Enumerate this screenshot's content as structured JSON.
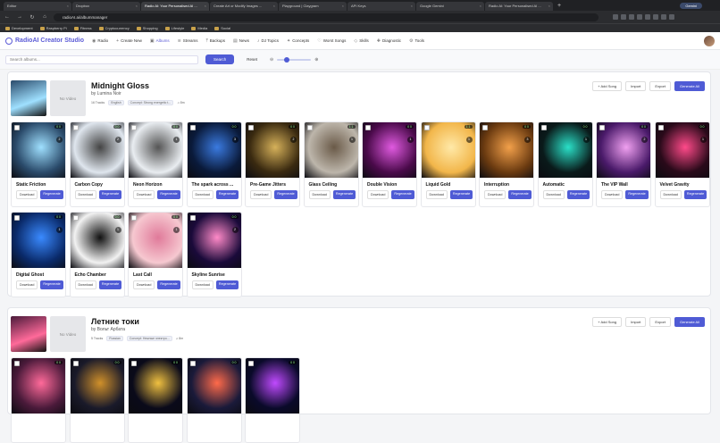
{
  "browser": {
    "tabs": [
      "Editor",
      "Dropbox",
      "Radio AI: Your Personalised AI ...",
      "Create Art or Modify Images ...",
      "Playground | Claygram",
      "API Keys",
      "Google Gemini",
      "Radio AI: Your Personalised AI ..."
    ],
    "gemini_label": "Gemini",
    "url": "radioAI.ai/albummanager",
    "bookmarks": [
      "Development",
      "Raspberry Pi",
      "Fitness",
      "Cryptocurrency",
      "Shopping",
      "Lifestyle",
      "Media",
      "Social"
    ]
  },
  "app": {
    "brand": "RadioAI Creator Studio",
    "nav": [
      {
        "label": "Radio",
        "icon": "radio-icon"
      },
      {
        "label": "Create New",
        "icon": "plus-icon"
      },
      {
        "label": "Albums",
        "icon": "album-icon"
      },
      {
        "label": "Streams",
        "icon": "stream-icon"
      },
      {
        "label": "Backups",
        "icon": "backup-icon"
      },
      {
        "label": "News",
        "icon": "news-icon"
      },
      {
        "label": "DJ Topics",
        "icon": "mic-icon"
      },
      {
        "label": "Concepts",
        "icon": "bulb-icon"
      },
      {
        "label": "Worst Songs",
        "icon": "thumb-down-icon"
      },
      {
        "label": "Skills",
        "icon": "skill-icon"
      },
      {
        "label": "Diagnostic",
        "icon": "diagnostic-icon"
      },
      {
        "label": "Tools",
        "icon": "tools-icon"
      }
    ],
    "active_nav": "Albums"
  },
  "toolbar": {
    "search_placeholder": "Search albums...",
    "search_label": "Search",
    "reset_label": "Reset",
    "zoom_level": 0.25
  },
  "albums": [
    {
      "title": "Midnight Gloss",
      "artist": "by Lumina Noir",
      "tracks": "16 Tracks",
      "language": "English",
      "concept": "Concept: Strong energetic t...",
      "likes": "♫ 8m",
      "no_video": "No Video",
      "actions": {
        "add": "+ Add Song",
        "import": "Import",
        "export": "Export",
        "generate": "Generate All"
      },
      "songs": [
        {
          "name": "Static Friction",
          "status": "0 0",
          "num": "2",
          "c1": "#2a4a6a",
          "c2": "#9fe0ff"
        },
        {
          "name": "Carbon Copy",
          "status": "0 0",
          "num": "2",
          "c1": "#dfe6ee",
          "c2": "#444"
        },
        {
          "name": "Neon Horizon",
          "status": "0 0",
          "num": "1",
          "c1": "#e9edf1",
          "c2": "#555"
        },
        {
          "name": "The spark across ...",
          "status": "0 0",
          "num": "3",
          "c1": "#0a1a3a",
          "c2": "#3a7ae0"
        },
        {
          "name": "Pre-Game Jitters",
          "status": "0 0",
          "num": "2",
          "c1": "#3a2a10",
          "c2": "#d6b15a"
        },
        {
          "name": "Glass Ceiling",
          "status": "1 1",
          "num": "1",
          "c1": "#bdb6ab",
          "c2": "#6a5a48"
        },
        {
          "name": "Double Vision",
          "status": "0 0",
          "num": "1",
          "c1": "#4a0a4a",
          "c2": "#e05ae0"
        },
        {
          "name": "Liquid Gold",
          "status": "1 1",
          "num": "1",
          "c1": "#f2b64a",
          "c2": "#ffe9a8"
        },
        {
          "name": "Interruption",
          "status": "0 0",
          "num": "3",
          "c1": "#6a3a10",
          "c2": "#f2a04a"
        },
        {
          "name": "Automatic",
          "status": "0 0",
          "num": "1",
          "c1": "#0a1a1a",
          "c2": "#2ae0c8"
        },
        {
          "name": "The VIP Wall",
          "status": "0 0",
          "num": "2",
          "c1": "#4a1a6a",
          "c2": "#f0a0f0"
        },
        {
          "name": "Velvet Gravity",
          "status": "0 0",
          "num": "1",
          "c1": "#2a0a1a",
          "c2": "#ff4a8a"
        },
        {
          "name": "Digital Ghost",
          "status": "0 0",
          "num": "1",
          "c1": "#0a2a6a",
          "c2": "#3a8aff"
        },
        {
          "name": "Echo Chamber",
          "status": "0 0",
          "num": "1",
          "c1": "#f2f2f2",
          "c2": "#111"
        },
        {
          "name": "Last Call",
          "status": "0 0",
          "num": "1",
          "c1": "#f6c8d0",
          "c2": "#e07a9a"
        },
        {
          "name": "Skyline Sunrise",
          "status": "0 0",
          "num": "2",
          "c1": "#1a0a3a",
          "c2": "#ff8ac8"
        }
      ],
      "btn_download": "Download",
      "btn_regenerate": "Regenerate"
    },
    {
      "title": "Летние токи",
      "artist": "by Вольт Арбата",
      "tracks": "5 Tracks",
      "language": "Russian",
      "concept": "Concept: Нежные электро...",
      "likes": "♫ 8m",
      "no_video": "No Video",
      "actions": {
        "add": "+ Add Song",
        "import": "Import",
        "export": "Export",
        "generate": "Generate All"
      },
      "songs": [
        {
          "name": "",
          "status": "0 0",
          "num": "",
          "c1": "#4a1a3a",
          "c2": "#ff6a9a"
        },
        {
          "name": "",
          "status": "0 0",
          "num": "",
          "c1": "#1a1a2a",
          "c2": "#d0902a"
        },
        {
          "name": "",
          "status": "0 0",
          "num": "",
          "c1": "#0a0a1a",
          "c2": "#f0c040"
        },
        {
          "name": "",
          "status": "0 0",
          "num": "",
          "c1": "#1a1a3a",
          "c2": "#ff6a4a"
        },
        {
          "name": "",
          "status": "0 0",
          "num": "",
          "c1": "#0a0a2a",
          "c2": "#c04aff"
        }
      ]
    }
  ]
}
